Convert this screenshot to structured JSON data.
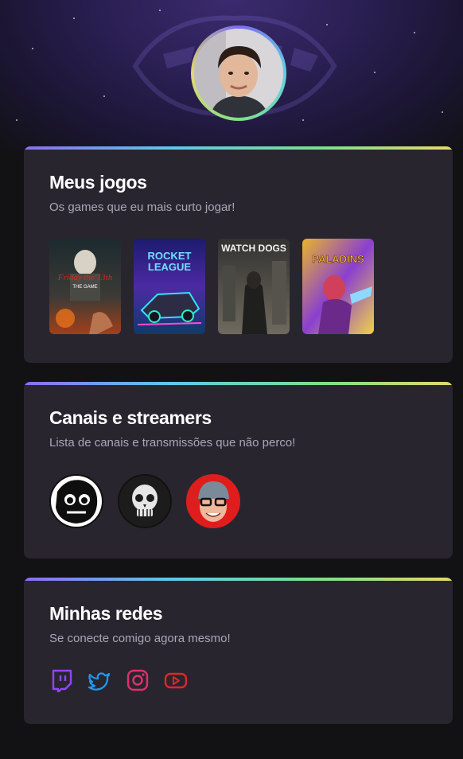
{
  "profile": {
    "avatar": "profile-photo"
  },
  "cards": {
    "games": {
      "title": "Meus jogos",
      "subtitle": "Os games que eu mais curto jogar!",
      "items": [
        {
          "name": "Friday the 13th The Game",
          "title_text": "Friday the 13th",
          "subtitle_text": "THE GAME",
          "color": "#c0392b"
        },
        {
          "name": "Rocket League",
          "title_text": "ROCKET",
          "subtitle_text": "LEAGUE",
          "color": "#3a8ee6"
        },
        {
          "name": "Watch Dogs",
          "title_text": "WATCH DOGS",
          "subtitle_text": "",
          "color": "#cfcfcf"
        },
        {
          "name": "Paladins",
          "title_text": "PALADINS",
          "subtitle_text": "",
          "color": "#f0b429"
        }
      ]
    },
    "channels": {
      "title": "Canais e streamers",
      "subtitle": "Lista de canais e transmissões que não perco!",
      "items": [
        {
          "name": "channel-1",
          "color": "#ffffff"
        },
        {
          "name": "channel-2",
          "color": "#1c1c1c"
        },
        {
          "name": "channel-3",
          "color": "#e01d1d"
        }
      ]
    },
    "socials": {
      "title": "Minhas redes",
      "subtitle": "Se conecte comigo agora mesmo!",
      "items": [
        {
          "name": "twitch-icon",
          "color": "#9146ff"
        },
        {
          "name": "twitter-icon",
          "color": "#1d9bf0"
        },
        {
          "name": "instagram-icon",
          "color": "#e1306c"
        },
        {
          "name": "youtube-icon",
          "color": "#e02626"
        }
      ]
    }
  }
}
